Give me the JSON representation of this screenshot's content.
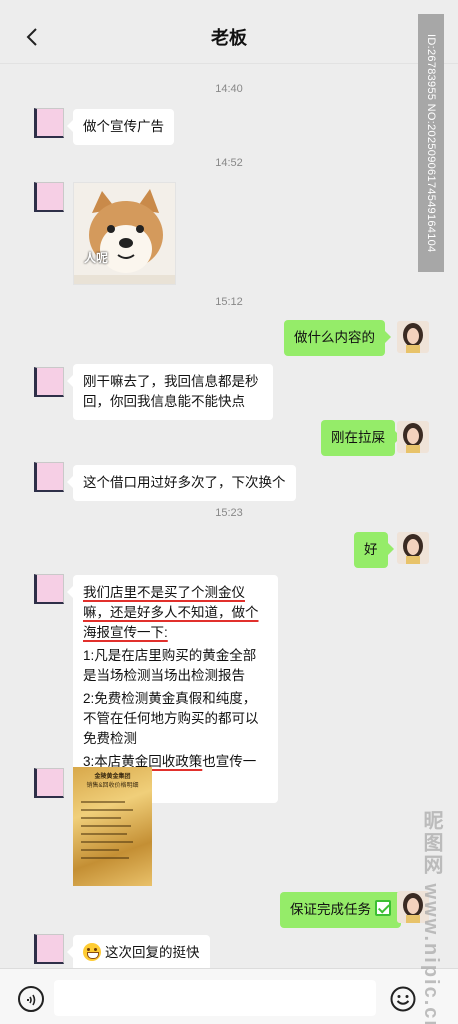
{
  "header": {
    "title": "老板"
  },
  "watermark": {
    "id_text": "ID:26783955 NO:20250906174549164104",
    "logo_text": "昵图网 www.nipic.cn"
  },
  "messages": {
    "time1": "14:40",
    "m1": "做个宣传广告",
    "time2": "14:52",
    "doge_caption": "人呢",
    "time3": "15:12",
    "m3": "做什么内容的",
    "m4": "刚干嘛去了，我回信息都是秒回，你回我信息能不能快点",
    "m5": "刚在拉屎",
    "m6": "这个借口用过好多次了，下次换个",
    "time4": "15:23",
    "m7": "好",
    "m8": {
      "p1": "我们店里不是买了个测金仪嘛，还是好多人不知道，做个海报宣传一下:",
      "p2": "1:凡是在店里购买的黄金全部是当场检测当场出检测报告",
      "p3": "2:免费检测黄金真假和纯度，不管在任何地方购买的都可以免费检测",
      "p4_a": "3:本店",
      "p4_b": "黄金回收政策",
      "p4_c": "也宣传一下"
    },
    "poster_title": "金陵黄金集团",
    "poster_subtitle": "销售&回收价格明细",
    "m10": "保证完成任务",
    "m11": "这次回复的挺快"
  },
  "input_bar": {
    "placeholder": "",
    "value": ""
  },
  "icons": {
    "back": "chevron-left-icon",
    "more": "more-dots-icon",
    "voice": "voice-icon",
    "emoji": "emoji-icon"
  },
  "colors": {
    "sent_bubble": "#95ec69",
    "received_bubble": "#ffffff",
    "background": "#ededed",
    "underline": "#e1302c"
  }
}
